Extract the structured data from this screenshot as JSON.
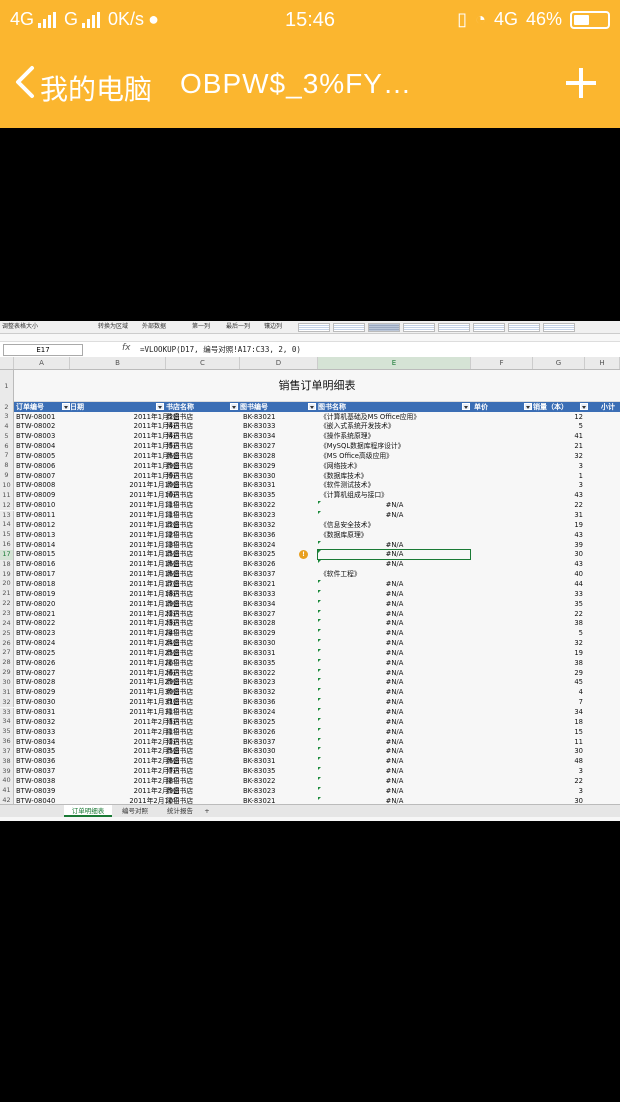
{
  "status_bar": {
    "network1": "4G",
    "network2": "G",
    "speed": "0K/s",
    "time": "15:46",
    "network3": "4G",
    "battery": "46%",
    "battery_level": 0.46
  },
  "app_bar": {
    "back_title": "我的电脑",
    "file_name": "OBPW$_3%FY…"
  },
  "ribbon": {
    "items": [
      "调整表格大小",
      "转换为区域",
      "外部数据",
      "第一列",
      "最后一列",
      "镶边列"
    ]
  },
  "formula_bar": {
    "cell_ref": "E17",
    "fx": "fx",
    "formula": "=VLOOKUP(D17, 编号对照!A17:C33, 2, 0)"
  },
  "columns": [
    "A",
    "B",
    "C",
    "D",
    "E",
    "F",
    "G",
    "H"
  ],
  "sheet": {
    "title": "销售订单明细表",
    "headers": [
      "订单编号",
      "日期",
      "书店名称",
      "图书编号",
      "图书名称",
      "单价",
      "销量（本）",
      "小计"
    ],
    "rows": [
      {
        "n": "3",
        "id": "BTW-08001",
        "date": "2011年1月2日",
        "store": "鼎盛书店",
        "code": "BK-83021",
        "name": "《计算机基础及MS Office应用》",
        "qty": "12"
      },
      {
        "n": "4",
        "id": "BTW-08002",
        "date": "2011年1月4日",
        "store": "博达书店",
        "code": "BK-83033",
        "name": "《嵌入式系统开发技术》",
        "qty": "5"
      },
      {
        "n": "5",
        "id": "BTW-08003",
        "date": "2011年1月4日",
        "store": "博达书店",
        "code": "BK-83034",
        "name": "《操作系统原理》",
        "qty": "41"
      },
      {
        "n": "6",
        "id": "BTW-08004",
        "date": "2011年1月5日",
        "store": "博达书店",
        "code": "BK-83027",
        "name": "《MySQL数据库程序设计》",
        "qty": "21"
      },
      {
        "n": "7",
        "id": "BTW-08005",
        "date": "2011年1月6日",
        "store": "鼎盛书店",
        "code": "BK-83028",
        "name": "《MS Office高级应用》",
        "qty": "32"
      },
      {
        "n": "8",
        "id": "BTW-08006",
        "date": "2011年1月9日",
        "store": "鼎盛书店",
        "code": "BK-83029",
        "name": "《网络技术》",
        "qty": "3"
      },
      {
        "n": "9",
        "id": "BTW-08007",
        "date": "2011年1月9日",
        "store": "博达书店",
        "code": "BK-83030",
        "name": "《数据库技术》",
        "qty": "1"
      },
      {
        "n": "10",
        "id": "BTW-08008",
        "date": "2011年1月10日",
        "store": "鼎盛书店",
        "code": "BK-83031",
        "name": "《软件测试技术》",
        "qty": "3"
      },
      {
        "n": "11",
        "id": "BTW-08009",
        "date": "2011年1月10日",
        "store": "博达书店",
        "code": "BK-83035",
        "name": "《计算机组成与接口》",
        "qty": "43"
      },
      {
        "n": "12",
        "id": "BTW-08010",
        "date": "2011年1月11日",
        "store": "隆华书店",
        "code": "BK-83022",
        "name": "#N/A",
        "qty": "22"
      },
      {
        "n": "13",
        "id": "BTW-08011",
        "date": "2011年1月11日",
        "store": "隆华书店",
        "code": "BK-83023",
        "name": "#N/A",
        "qty": "31"
      },
      {
        "n": "14",
        "id": "BTW-08012",
        "date": "2011年1月12日",
        "store": "鼎盛书店",
        "code": "BK-83032",
        "name": "《信息安全技术》",
        "qty": "19"
      },
      {
        "n": "15",
        "id": "BTW-08013",
        "date": "2011年1月12日",
        "store": "隆华书店",
        "code": "BK-83036",
        "name": "《数据库原理》",
        "qty": "43"
      },
      {
        "n": "16",
        "id": "BTW-08014",
        "date": "2011年1月13日",
        "store": "隆华书店",
        "code": "BK-83024",
        "name": "#N/A",
        "qty": "39"
      },
      {
        "n": "17",
        "id": "BTW-08015",
        "date": "2011年1月15日",
        "store": "鼎盛书店",
        "code": "BK-83025",
        "name": "#N/A",
        "qty": "30"
      },
      {
        "n": "18",
        "id": "BTW-08016",
        "date": "2011年1月16日",
        "store": "鼎盛书店",
        "code": "BK-83026",
        "name": "#N/A",
        "qty": "43"
      },
      {
        "n": "19",
        "id": "BTW-08017",
        "date": "2011年1月16日",
        "store": "鼎盛书店",
        "code": "BK-83037",
        "name": "《软件工程》",
        "qty": "40"
      },
      {
        "n": "20",
        "id": "BTW-08018",
        "date": "2011年1月17日",
        "store": "鼎盛书店",
        "code": "BK-83021",
        "name": "#N/A",
        "qty": "44"
      },
      {
        "n": "21",
        "id": "BTW-08019",
        "date": "2011年1月18日",
        "store": "博达书店",
        "code": "BK-83033",
        "name": "#N/A",
        "qty": "33"
      },
      {
        "n": "22",
        "id": "BTW-08020",
        "date": "2011年1月19日",
        "store": "鼎盛书店",
        "code": "BK-83034",
        "name": "#N/A",
        "qty": "35"
      },
      {
        "n": "23",
        "id": "BTW-08021",
        "date": "2011年1月22日",
        "store": "博达书店",
        "code": "BK-83027",
        "name": "#N/A",
        "qty": "22"
      },
      {
        "n": "24",
        "id": "BTW-08022",
        "date": "2011年1月23日",
        "store": "博达书店",
        "code": "BK-83028",
        "name": "#N/A",
        "qty": "38"
      },
      {
        "n": "25",
        "id": "BTW-08023",
        "date": "2011年1月24日",
        "store": "隆华书店",
        "code": "BK-83029",
        "name": "#N/A",
        "qty": "5"
      },
      {
        "n": "26",
        "id": "BTW-08024",
        "date": "2011年1月24日",
        "store": "鼎盛书店",
        "code": "BK-83030",
        "name": "#N/A",
        "qty": "32"
      },
      {
        "n": "27",
        "id": "BTW-08025",
        "date": "2011年1月25日",
        "store": "鼎盛书店",
        "code": "BK-83031",
        "name": "#N/A",
        "qty": "19"
      },
      {
        "n": "28",
        "id": "BTW-08026",
        "date": "2011年1月26日",
        "store": "隆华书店",
        "code": "BK-83035",
        "name": "#N/A",
        "qty": "38"
      },
      {
        "n": "29",
        "id": "BTW-08027",
        "date": "2011年1月26日",
        "store": "博达书店",
        "code": "BK-83022",
        "name": "#N/A",
        "qty": "29"
      },
      {
        "n": "30",
        "id": "BTW-08028",
        "date": "2011年1月29日",
        "store": "鼎盛书店",
        "code": "BK-83023",
        "name": "#N/A",
        "qty": "45"
      },
      {
        "n": "31",
        "id": "BTW-08029",
        "date": "2011年1月30日",
        "store": "鼎盛书店",
        "code": "BK-83032",
        "name": "#N/A",
        "qty": "4"
      },
      {
        "n": "32",
        "id": "BTW-08030",
        "date": "2011年1月31日",
        "store": "鼎盛书店",
        "code": "BK-83036",
        "name": "#N/A",
        "qty": "7"
      },
      {
        "n": "33",
        "id": "BTW-08031",
        "date": "2011年1月31日",
        "store": "隆华书店",
        "code": "BK-83024",
        "name": "#N/A",
        "qty": "34"
      },
      {
        "n": "34",
        "id": "BTW-08032",
        "date": "2011年2月1日",
        "store": "博达书店",
        "code": "BK-83025",
        "name": "#N/A",
        "qty": "18"
      },
      {
        "n": "35",
        "id": "BTW-08033",
        "date": "2011年2月1日",
        "store": "隆华书店",
        "code": "BK-83026",
        "name": "#N/A",
        "qty": "15"
      },
      {
        "n": "36",
        "id": "BTW-08034",
        "date": "2011年2月2日",
        "store": "博达书店",
        "code": "BK-83037",
        "name": "#N/A",
        "qty": "11"
      },
      {
        "n": "37",
        "id": "BTW-08035",
        "date": "2011年2月5日",
        "store": "鼎盛书店",
        "code": "BK-83030",
        "name": "#N/A",
        "qty": "30"
      },
      {
        "n": "38",
        "id": "BTW-08036",
        "date": "2011年2月6日",
        "store": "鼎盛书店",
        "code": "BK-83031",
        "name": "#N/A",
        "qty": "48"
      },
      {
        "n": "39",
        "id": "BTW-08037",
        "date": "2011年2月7日",
        "store": "博达书店",
        "code": "BK-83035",
        "name": "#N/A",
        "qty": "3"
      },
      {
        "n": "40",
        "id": "BTW-08038",
        "date": "2011年2月8日",
        "store": "隆华书店",
        "code": "BK-83022",
        "name": "#N/A",
        "qty": "22"
      },
      {
        "n": "41",
        "id": "BTW-08039",
        "date": "2011年2月9日",
        "store": "鼎盛书店",
        "code": "BK-83023",
        "name": "#N/A",
        "qty": "3"
      },
      {
        "n": "42",
        "id": "BTW-08040",
        "date": "2011年2月10日",
        "store": "隆华书店",
        "code": "BK-83021",
        "name": "#N/A",
        "qty": "30"
      }
    ]
  },
  "sheet_tabs": [
    "订单明细表",
    "编号对照",
    "统计报告",
    "+"
  ]
}
